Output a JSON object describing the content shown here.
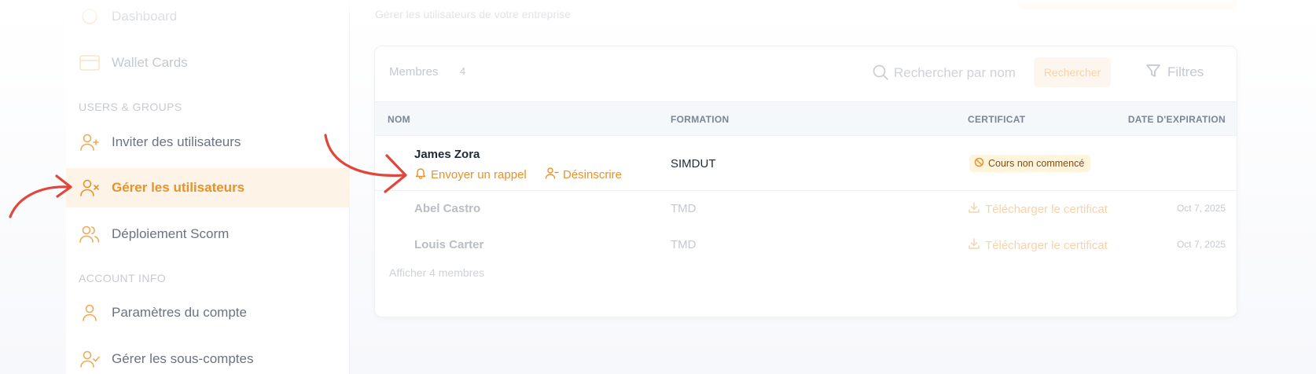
{
  "sidebar": {
    "items": [
      {
        "label": "Dashboard"
      },
      {
        "label": "Wallet Cards"
      },
      {
        "label": "Inviter des utilisateurs"
      },
      {
        "label": "Gérer les utilisateurs"
      },
      {
        "label": "Déploiement Scorm"
      },
      {
        "label": "Paramètres du compte"
      },
      {
        "label": "Gérer les sous-comptes"
      }
    ],
    "sections": [
      "USERS & GROUPS",
      "ACCOUNT INFO"
    ]
  },
  "header": {
    "subtitle": "Gérer les utilisateurs de votre entreprise"
  },
  "members": {
    "label": "Membres",
    "count": "4",
    "search_placeholder": "Rechercher par nom",
    "search_button": "Rechercher",
    "filter_button": "Filtres",
    "show_more": "Afficher 4 membres"
  },
  "table": {
    "headers": [
      "NOM",
      "FORMATION",
      "CERTIFICAT",
      "DATE D'EXPIRATION"
    ],
    "rows": [
      {
        "name": "James Zora",
        "formation": "SIMDUT",
        "status": "Cours non commencé",
        "reminder": "Envoyer un rappel",
        "unsubscribe": "Désinscrire"
      },
      {
        "name": "Abel Castro",
        "formation": "TMD",
        "certificate": "Télécharger le certificat",
        "date": "Oct 7, 2025"
      },
      {
        "name": "Louis Carter",
        "formation": "TMD",
        "certificate": "Télécharger le certificat",
        "date": "Oct 7, 2025"
      }
    ]
  },
  "colors": {
    "accent": "#e8922a",
    "arrow": "#e0463a",
    "badge_bg": "#fff4dc"
  }
}
